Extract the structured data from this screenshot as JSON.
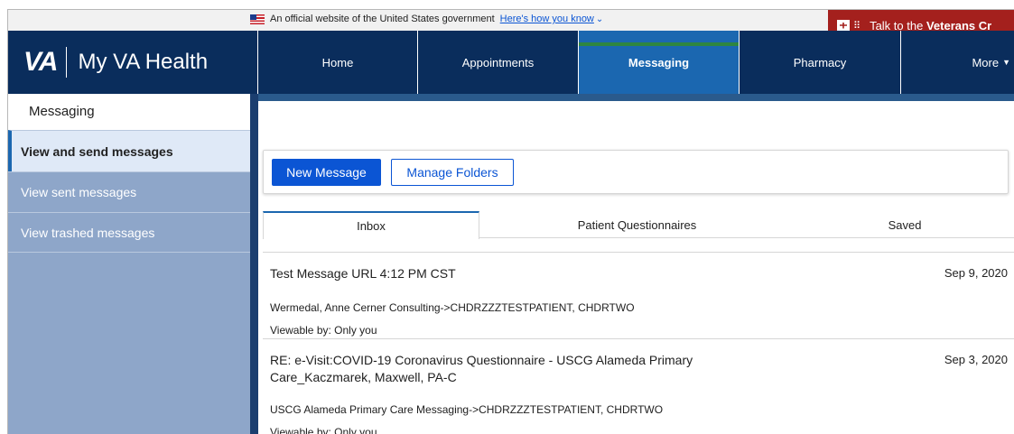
{
  "gov_banner": {
    "text": "An official website of the United States government",
    "link": "Here's how you know",
    "crisis_text": "Talk to the",
    "crisis_bold": "Veterans Cr"
  },
  "header": {
    "logo": "VA",
    "app_title": "My VA Health",
    "nav": [
      {
        "label": "Home"
      },
      {
        "label": "Appointments"
      },
      {
        "label": "Messaging"
      },
      {
        "label": "Pharmacy"
      },
      {
        "label": "More"
      }
    ]
  },
  "sidebar": {
    "title": "Messaging",
    "items": [
      {
        "label": "View and send messages"
      },
      {
        "label": "View sent messages"
      },
      {
        "label": "View trashed messages"
      }
    ]
  },
  "toolbar": {
    "new_message": "New Message",
    "manage_folders": "Manage Folders"
  },
  "tabs": [
    {
      "label": "Inbox"
    },
    {
      "label": "Patient Questionnaires"
    },
    {
      "label": "Saved"
    }
  ],
  "messages": [
    {
      "subject": "Test Message URL 4:12 PM CST",
      "date": "Sep 9, 2020",
      "from": "Wermedal, Anne Cerner Consulting->CHDRZZZTESTPATIENT, CHDRTWO",
      "viewable": "Viewable by: Only you"
    },
    {
      "subject": "RE: e-Visit:COVID-19 Coronavirus Questionnaire - USCG Alameda Primary Care_Kaczmarek, Maxwell, PA-C",
      "date": "Sep 3, 2020",
      "from": "USCG Alameda Primary Care Messaging->CHDRZZZTESTPATIENT, CHDRTWO",
      "viewable": "Viewable by: Only you"
    }
  ],
  "colors": {
    "nav_bg": "#0a2d5c",
    "active_tab": "#1b67b0",
    "active_accent": "#2e8540",
    "sidebar_bg": "#8ea6c9",
    "primary_button": "#0b55d4",
    "crisis_red": "#a4201d"
  }
}
